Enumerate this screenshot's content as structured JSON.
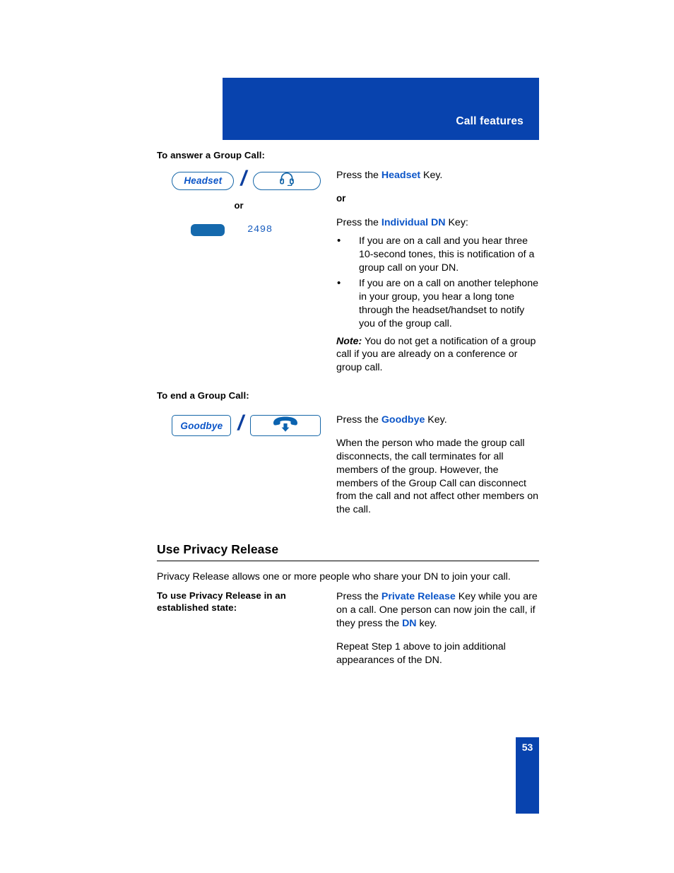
{
  "header": {
    "title": "Call features",
    "band_color": "#0843AE"
  },
  "colors": {
    "header_blue": "#0843AE",
    "accent_blue": "#0B55C8",
    "key_outline_blue": "#1566A8",
    "dn_key_blue": "#1569AD",
    "slash_blue": "#0B3E9E",
    "dn_number_blue": "#1B5FBF"
  },
  "sections": {
    "answer_group_call": {
      "label": "To answer a Group Call:",
      "keys": {
        "headset_text_key": "Headset",
        "headset_icon_key": "headset-icon",
        "or_divider": "or",
        "dn_key_number": "2498"
      },
      "step1": {
        "prefix": "Press the ",
        "accent": "Headset",
        "suffix": " Key."
      },
      "or": "or",
      "step2": {
        "prefix": "Press the ",
        "accent": "Individual DN",
        "suffix": " Key:"
      },
      "bullets": [
        "If you are on a call and you hear three 10-second tones, this is notification of a group call on your DN.",
        "If you are on a call on another telephone in your group, you hear a long tone through the headset/handset to notify you of the group call."
      ],
      "note": {
        "lead": "Note:",
        "text": " You do not get a notification of a group call if you are already on a conference or group call."
      }
    },
    "end_group_call": {
      "label": "To end a Group Call:",
      "keys": {
        "goodbye_text_key": "Goodbye",
        "goodbye_icon_key": "handset-down-arrow-icon"
      },
      "step1": {
        "prefix": "Press the ",
        "accent": "Goodbye",
        "suffix": " Key."
      },
      "paragraph": "When the person who made the group call disconnects, the call terminates for all members of the group. However, the members of the Group Call can disconnect from the call and not affect other members on the call."
    },
    "privacy_release": {
      "heading": "Use Privacy Release",
      "intro": "Privacy Release allows one or more people who share your DN to join your call.",
      "label_line1_bold": "To use Privacy Release",
      "label_line1_rest": " in an",
      "label_line2": "established state:",
      "step1": {
        "part1": "Press the ",
        "accent1": "Private Release",
        "part2": " Key while you are on a call. One person can now join the call, if they press the ",
        "accent2": "DN",
        "part3": " key."
      },
      "step2": "Repeat Step 1 above to join additional appearances of the DN."
    }
  },
  "footer": {
    "page_number": "53"
  }
}
